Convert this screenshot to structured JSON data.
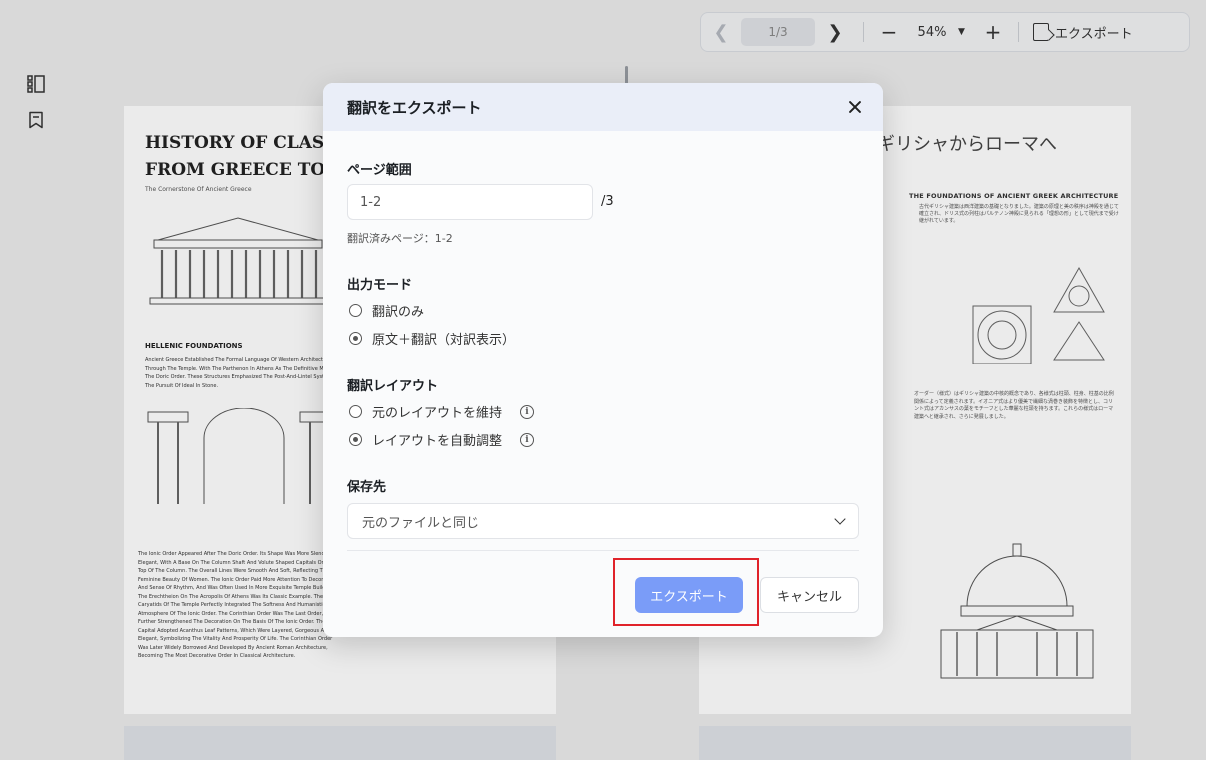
{
  "toolbar": {
    "page_indicator": "1/3",
    "zoom": "54%",
    "export_label": "エクスポート"
  },
  "page_left": {
    "title": "HISTORY OF CLASSI\nFROM GREECE TO RO",
    "subtitle": "The Cornerstone Of Ancient Greece",
    "heading": "HELLENIC FOUNDATIONS",
    "body1": "Ancient Greece Established The Formal Language Of Western Architecture Through The Temple. With The Parthenon In Athens As The Definitive Model Of The Doric Order. These Structures Emphasized The Post-And-Lintel System And The Pursuit Of Ideal In Stone.",
    "body2": "The Ionic Order Appeared After The Doric Order. Its Shape Was More Slender And Elegant, With A Base On The Column Shaft And Volute Shaped Capitals On The Top Of The Column. The Overall Lines Were Smooth And Soft, Reflecting The Feminine Beauty Of Women. The Ionic Order Paid More Attention To Decoration And Sense Of Rhythm, And Was Often Used In More Exquisite Temple Buildings. The Erechtheion On The Acropolis Of Athens Was Its Classic Example. The Caryatids Of The Temple Perfectly Integrated The Softness And Humanistic Atmosphere Of The Ionic Order. The Corinthian Order Was The Last Order, Which Further Strengthened The Decoration On The Basis Of The Ionic Order. The Capital Adopted Acanthus Leaf Patterns, Which Were Layered, Gorgeous And Elegant, Symbolizing The Vitality And Prosperity Of Life. The Corinthian Order Was Later Widely Borrowed And Developed By Ancient Roman Architecture, Becoming The Most Decorative Order In Classical Architecture."
  },
  "page_right": {
    "title": "ギリシャからローマへ",
    "heading": "THE FOUNDATIONS OF ANCIENT GREEK ARCHITECTURE",
    "body1": "古代ギリシャ建築は西洋建築の基礎となりました。建築の原理と美の秩序は神殿を通じて確立され、ドリス式の列柱はパルテノン神殿に見られる「理想の形」として現代まで受け継がれています。",
    "body2": "オーダー（様式）はギリシャ建築の中核的概念であり、各様式は柱頭、柱身、柱基の比例関係によって定義されます。イオニア式はより優美で繊細な渦巻き装飾を特徴とし、コリント式はアカンサスの葉をモチーフとした華麗な柱頭を持ちます。これらの様式はローマ建築へと継承され、さらに発展しました。"
  },
  "dialog": {
    "title": "翻訳をエクスポート",
    "page_range": {
      "label": "ページ範囲",
      "value": "1-2",
      "total": "/3",
      "note": "翻訳済みページ：1-2"
    },
    "output_mode": {
      "label": "出力モード",
      "options": [
        "翻訳のみ",
        "原文＋翻訳（対訳表示）"
      ],
      "selected": 1
    },
    "layout": {
      "label": "翻訳レイアウト",
      "options": [
        "元のレイアウトを維持",
        "レイアウトを自動調整"
      ],
      "selected": 1
    },
    "save_to": {
      "label": "保存先",
      "value": "元のファイルと同じ"
    },
    "export_button": "エクスポート",
    "cancel_button": "キャンセル"
  },
  "colors": {
    "primary_button": "#7a9cf8",
    "highlight_box": "#e0232a",
    "dialog_header": "#eaeef8"
  }
}
